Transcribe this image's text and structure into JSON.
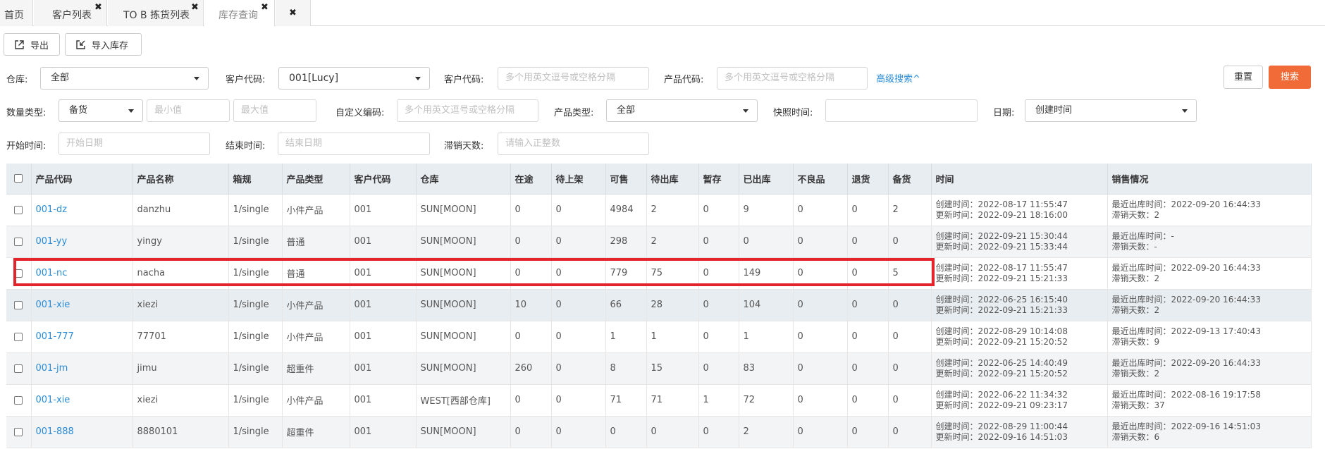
{
  "tabs": [
    {
      "label": "首页",
      "closable": false
    },
    {
      "label": "客户列表",
      "closable": true
    },
    {
      "label": "TO B 拣货列表",
      "closable": true
    },
    {
      "label": "库存查询",
      "closable": true,
      "active": true
    },
    {
      "label": "",
      "closable": true
    }
  ],
  "toolbar": {
    "export_label": "导出",
    "import_label": "导入库存"
  },
  "filters": {
    "warehouse_label": "仓库:",
    "warehouse_value": "全部",
    "customer_code_label": "客户代码:",
    "customer_code_value": "001[Lucy]",
    "customer_codes_label": "客户代码:",
    "customer_codes_placeholder": "多个用英文逗号或空格分隔",
    "product_code_label": "产品代码:",
    "product_code_placeholder": "多个用英文逗号或空格分隔",
    "advanced_search": "高级搜索^",
    "reset": "重置",
    "search": "搜索",
    "qty_type_label": "数量类型:",
    "qty_type_value": "备货",
    "min_placeholder": "最小值",
    "max_placeholder": "最大值",
    "custom_code_label": "自定义编码:",
    "custom_code_placeholder": "多个用英文逗号或空格分隔",
    "product_type_label": "产品类型:",
    "product_type_value": "全部",
    "snapshot_label": "快照时间:",
    "date_label": "日期:",
    "date_value": "创建时间",
    "start_label": "开始时间:",
    "start_placeholder": "开始日期",
    "end_label": "结束时间:",
    "end_placeholder": "结束日期",
    "slow_label": "滞销天数:",
    "slow_placeholder": "请输入正整数"
  },
  "table": {
    "headers": [
      "产品代码",
      "产品名称",
      "箱规",
      "产品类型",
      "客户代码",
      "仓库",
      "在途",
      "待上架",
      "可售",
      "待出库",
      "暂存",
      "已出库",
      "不良品",
      "退货",
      "备货",
      "时间",
      "销售情况"
    ],
    "rows": [
      {
        "code": "001-dz",
        "name": "danzhu",
        "spec": "1/single",
        "type": "小件产品",
        "customer": "001",
        "warehouse": "SUN[MOON]",
        "transit": "0",
        "pending_shelf": "0",
        "sellable": "4984",
        "pending_out": "2",
        "staging": "0",
        "shipped": "9",
        "defective": "0",
        "returned": "0",
        "stock": "2",
        "created": "创建时间：2022-08-17 11:55:47",
        "updated": "更新时间：2022-09-21 18:16:00",
        "last_out": "最近出库时间：2022-09-20 16:44:33",
        "slow_days": "滞销天数：2"
      },
      {
        "code": "001-yy",
        "name": "yingy",
        "spec": "1/single",
        "type": "普通",
        "customer": "001",
        "warehouse": "SUN[MOON]",
        "transit": "0",
        "pending_shelf": "0",
        "sellable": "298",
        "pending_out": "2",
        "staging": "0",
        "shipped": "0",
        "defective": "0",
        "returned": "0",
        "stock": "0",
        "created": "创建时间：2022-09-21 15:30:44",
        "updated": "更新时间：2022-09-21 15:33:44",
        "last_out": "最近出库时间：-",
        "slow_days": "滞销天数：-"
      },
      {
        "code": "001-nc",
        "name": "nacha",
        "spec": "1/single",
        "type": "普通",
        "customer": "001",
        "warehouse": "SUN[MOON]",
        "transit": "0",
        "pending_shelf": "0",
        "sellable": "779",
        "pending_out": "75",
        "staging": "0",
        "shipped": "149",
        "defective": "0",
        "returned": "0",
        "stock": "5",
        "created": "创建时间：2022-08-17 11:55:47",
        "updated": "更新时间：2022-09-21 15:21:33",
        "last_out": "最近出库时间：2022-09-20 16:44:33",
        "slow_days": "滞销天数：2"
      },
      {
        "code": "001-xie",
        "name": "xiezi",
        "spec": "1/single",
        "type": "小件产品",
        "customer": "001",
        "warehouse": "SUN[MOON]",
        "transit": "10",
        "pending_shelf": "0",
        "sellable": "66",
        "pending_out": "28",
        "staging": "0",
        "shipped": "104",
        "defective": "0",
        "returned": "0",
        "stock": "0",
        "created": "创建时间：2022-06-25 16:15:40",
        "updated": "更新时间：2022-09-21 15:21:33",
        "last_out": "最近出库时间：2022-09-20 16:44:33",
        "slow_days": "滞销天数：2"
      },
      {
        "code": "001-777",
        "name": "77701",
        "spec": "1/single",
        "type": "小件产品",
        "customer": "001",
        "warehouse": "SUN[MOON]",
        "transit": "0",
        "pending_shelf": "0",
        "sellable": "1",
        "pending_out": "1",
        "staging": "0",
        "shipped": "1",
        "defective": "0",
        "returned": "0",
        "stock": "0",
        "created": "创建时间：2022-08-29 10:14:08",
        "updated": "更新时间：2022-09-21 15:20:52",
        "last_out": "最近出库时间：2022-09-13 17:40:43",
        "slow_days": "滞销天数：9"
      },
      {
        "code": "001-jm",
        "name": "jimu",
        "spec": "1/single",
        "type": "超重件",
        "customer": "001",
        "warehouse": "SUN[MOON]",
        "transit": "260",
        "pending_shelf": "0",
        "sellable": "8",
        "pending_out": "15",
        "staging": "0",
        "shipped": "83",
        "defective": "0",
        "returned": "0",
        "stock": "0",
        "created": "创建时间：2022-06-25 14:40:49",
        "updated": "更新时间：2022-09-21 15:20:52",
        "last_out": "最近出库时间：2022-09-20 16:44:33",
        "slow_days": "滞销天数：2"
      },
      {
        "code": "001-xie",
        "name": "xiezi",
        "spec": "1/single",
        "type": "小件产品",
        "customer": "001",
        "warehouse": "WEST[西部仓库]",
        "transit": "0",
        "pending_shelf": "0",
        "sellable": "71",
        "pending_out": "71",
        "staging": "1",
        "shipped": "72",
        "defective": "0",
        "returned": "0",
        "stock": "0",
        "created": "创建时间：2022-06-22 11:34:32",
        "updated": "更新时间：2022-09-21 09:23:17",
        "last_out": "最近出库时间：2022-08-16 19:17:58",
        "slow_days": "滞销天数：37"
      },
      {
        "code": "001-888",
        "name": "8880101",
        "spec": "1/single",
        "type": "超重件",
        "customer": "001",
        "warehouse": "SUN[MOON]",
        "transit": "0",
        "pending_shelf": "0",
        "sellable": "0",
        "pending_out": "0",
        "staging": "0",
        "shipped": "2",
        "defective": "0",
        "returned": "0",
        "stock": "0",
        "created": "创建时间：2022-08-29 11:00:44",
        "updated": "更新时间：2022-09-16 14:51:03",
        "last_out": "最近出库时间：2022-09-16 14:51:03",
        "slow_days": "滞销天数：6"
      }
    ]
  },
  "colors": {
    "accent": "#f06b37",
    "link": "#2a8bd6",
    "highlight_box": "#e3242b",
    "header_bg": "#e8edf2"
  }
}
